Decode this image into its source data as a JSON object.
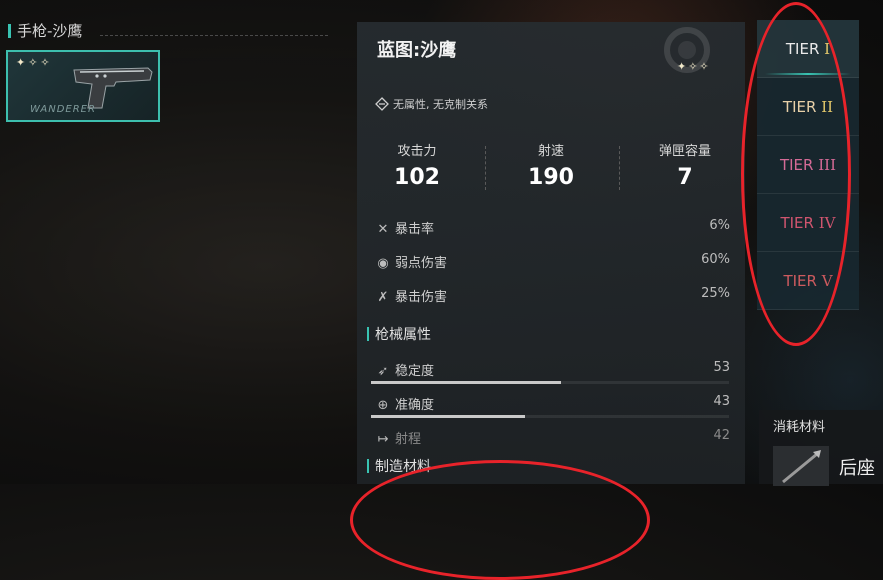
{
  "weapon_list": {
    "category_title": "手枪-沙鹰",
    "card": {
      "stars": "✦✧✧",
      "brand": "WANDERER"
    }
  },
  "detail": {
    "title": "蓝图:沙鹰",
    "stars": "✦✧✧",
    "attribute": "无属性, 无克制关系",
    "main_stats": [
      {
        "label": "攻击力",
        "value": "102"
      },
      {
        "label": "射速",
        "value": "190"
      },
      {
        "label": "弹匣容量",
        "value": "7"
      }
    ],
    "crit_stats": [
      {
        "icon": "crit-rate-icon",
        "label": "暴击率",
        "value": "6%"
      },
      {
        "icon": "weakpoint-icon",
        "label": "弱点伤害",
        "value": "60%"
      },
      {
        "icon": "crit-damage-icon",
        "label": "暴击伤害",
        "value": "25%"
      }
    ],
    "section_gun": "枪械属性",
    "gun_stats": [
      {
        "label": "稳定度",
        "value": "53",
        "fill": 0.53
      },
      {
        "label": "准确度",
        "value": "43",
        "fill": 0.43
      },
      {
        "label": "射程",
        "value": "42",
        "fill": 0.42
      }
    ],
    "section_craft": "制造材料"
  },
  "tiers": [
    {
      "label": "TIER",
      "roman": "I",
      "color": "#eaeaea",
      "roman_color": "#e3c86b",
      "active": true
    },
    {
      "label": "TIER",
      "roman": "II",
      "color": "#e8d0a8",
      "roman_color": "#e3c86b",
      "active": false
    },
    {
      "label": "TIER",
      "roman": "III",
      "color": "#d46a96",
      "roman_color": "#d46a96",
      "active": false
    },
    {
      "label": "TIER",
      "roman": "IV",
      "color": "#d0556f",
      "roman_color": "#d0556f",
      "active": false
    },
    {
      "label": "TIER",
      "roman": "V",
      "color": "#cc5a5e",
      "roman_color": "#cc5a5e",
      "active": false
    }
  ],
  "consume": {
    "label": "消耗材料",
    "item_name": "后座"
  },
  "colors": {
    "accent": "#39c3b2",
    "annotation": "#e8232a"
  }
}
